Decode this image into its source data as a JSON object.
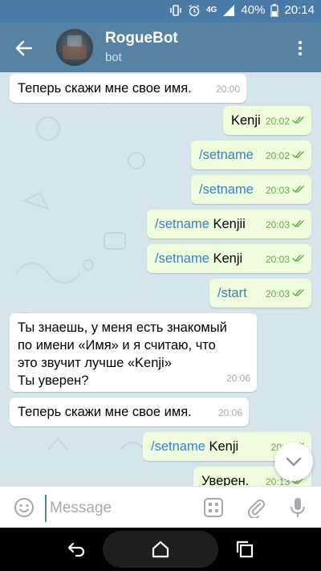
{
  "status_bar": {
    "network": "4G",
    "battery": "40%",
    "time": "20:14",
    "icons": [
      "vibrate-icon",
      "alarm-icon",
      "signal-icon",
      "battery-icon"
    ]
  },
  "header": {
    "title": "RogueBot",
    "subtitle": "bot",
    "back_icon": "arrow-left-icon",
    "menu_icon": "more-vertical-icon"
  },
  "messages": [
    {
      "dir": "in",
      "text": "Теперь скажи мне свое имя.",
      "time": "20:00"
    },
    {
      "dir": "out",
      "parts": [
        {
          "t": "Kenji",
          "cmd": false
        }
      ],
      "time": "20:02"
    },
    {
      "dir": "out",
      "parts": [
        {
          "t": "/setname",
          "cmd": true
        }
      ],
      "time": "20:02"
    },
    {
      "dir": "out",
      "parts": [
        {
          "t": "/setname",
          "cmd": true
        }
      ],
      "time": "20:03"
    },
    {
      "dir": "out",
      "parts": [
        {
          "t": "/setname",
          "cmd": true
        },
        {
          "t": " Kenjii",
          "cmd": false
        }
      ],
      "time": "20:03"
    },
    {
      "dir": "out",
      "parts": [
        {
          "t": "/setname",
          "cmd": true
        },
        {
          "t": " Kenji",
          "cmd": false
        }
      ],
      "time": "20:03"
    },
    {
      "dir": "out",
      "parts": [
        {
          "t": "/start",
          "cmd": true
        }
      ],
      "time": "20:03"
    },
    {
      "dir": "in",
      "lines": [
        "Ты знаешь, у меня есть знакомый",
        "по имени «Имя» и я считаю, что",
        "это звучит лучше «Kenji»",
        "Ты уверен?"
      ],
      "time": "20:06"
    },
    {
      "dir": "in",
      "text": "Теперь скажи мне свое имя.",
      "time": "20:06"
    },
    {
      "dir": "out",
      "parts": [
        {
          "t": "/setname",
          "cmd": true
        },
        {
          "t": " Kenji",
          "cmd": false
        }
      ],
      "time": "20:0"
    },
    {
      "dir": "out",
      "parts": [
        {
          "t": "Уверен.",
          "cmd": false
        }
      ],
      "time": "20:13"
    }
  ],
  "input": {
    "placeholder": "Message",
    "value": "",
    "emoji_icon": "emoji-icon",
    "bot_keyboard_icon": "bot-keyboard-icon",
    "attach_icon": "paperclip-icon",
    "mic_icon": "microphone-icon"
  },
  "scroll_button_icon": "chevron-down-icon",
  "nav": {
    "back_icon": "nav-back-icon",
    "home_icon": "nav-home-icon",
    "recents_icon": "nav-recents-icon"
  },
  "colors": {
    "header": "#5682a3",
    "status_bar": "#4a7aa6",
    "chat_bg": "#d6e4ec",
    "incoming": "#ffffff",
    "outgoing": "#effdde",
    "command_link": "#3a7fc1",
    "check": "#6aa84f"
  }
}
